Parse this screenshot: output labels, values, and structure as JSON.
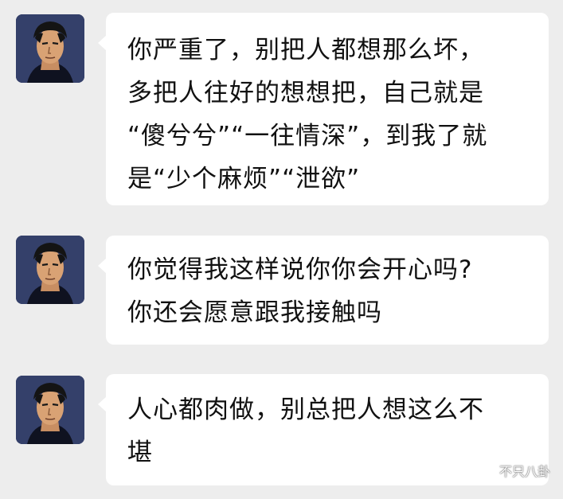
{
  "chat": {
    "messages": [
      {
        "sender_avatar": "anime-man-avatar",
        "text": "你严重了，别把人都想那么坏，\n多把人往好的想想把，自己就是\n“傻兮兮”“一往情深”，到我了就\n是“少个麻烦”“泄欲”"
      },
      {
        "sender_avatar": "anime-man-avatar",
        "text": "你觉得我这样说你你会开心吗?\n你还会愿意跟我接触吗"
      },
      {
        "sender_avatar": "anime-man-avatar",
        "text": "人心都肉做，别总把人想这么不\n堪"
      }
    ]
  },
  "watermark": {
    "icon": "wechat-channel-icon",
    "text": "不只八卦"
  },
  "colors": {
    "background": "#ededed",
    "bubble": "#ffffff",
    "text": "#111111"
  }
}
